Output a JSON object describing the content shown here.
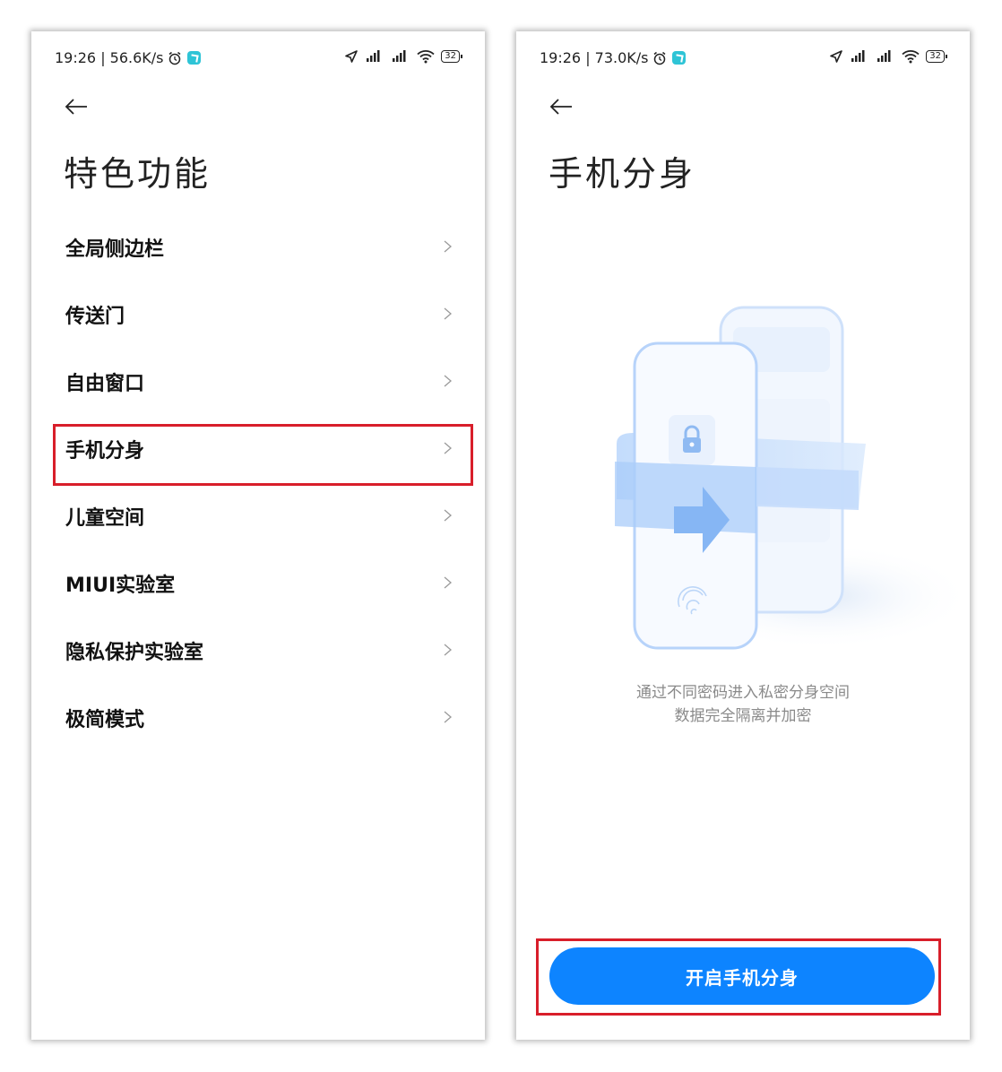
{
  "left_screen": {
    "status": {
      "time_speed": "19:26 | 56.6K/s",
      "battery": "32"
    },
    "title": "特色功能",
    "menu_items": [
      {
        "label": "全局侧边栏"
      },
      {
        "label": "传送门"
      },
      {
        "label": "自由窗口"
      },
      {
        "label": "手机分身"
      },
      {
        "label": "儿童空间"
      },
      {
        "label": "MIUI实验室"
      },
      {
        "label": "隐私保护实验室"
      },
      {
        "label": "极简模式"
      }
    ]
  },
  "right_screen": {
    "status": {
      "time_speed": "19:26 | 73.0K/s",
      "battery": "32"
    },
    "title": "手机分身",
    "description_line1": "通过不同密码进入私密分身空间",
    "description_line2": "数据完全隔离并加密",
    "button_label": "开启手机分身"
  },
  "colors": {
    "accent_blue": "#0d84ff",
    "highlight_red": "#d81e2a",
    "app_icon": "#2ec4d6"
  }
}
